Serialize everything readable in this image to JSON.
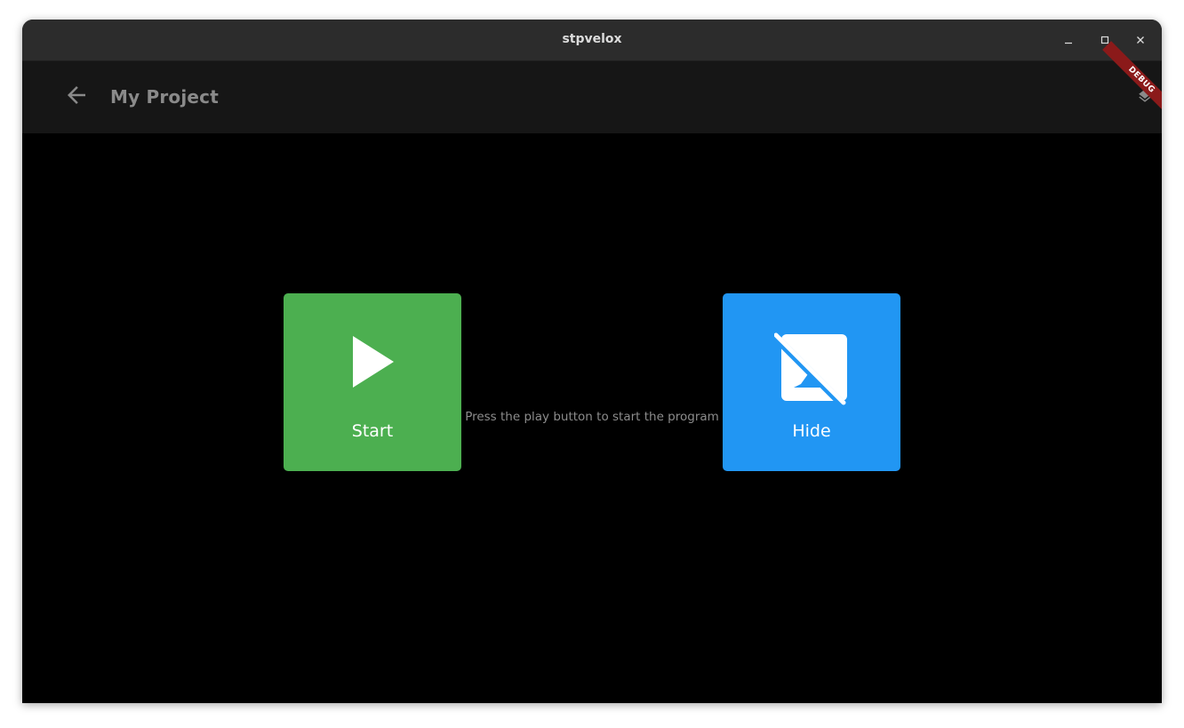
{
  "window": {
    "title": "stpvelox",
    "controls": [
      "minimize-icon",
      "maximize-icon",
      "close-icon"
    ]
  },
  "appbar": {
    "title": "My Project",
    "back_icon": "arrow-back-icon",
    "layers_icon": "layers-icon",
    "debug_banner": "DEBUG"
  },
  "main": {
    "start_tile": {
      "label": "Start",
      "icon": "play-icon",
      "color": "#4caf50"
    },
    "hint": "Press the play button to start the program",
    "hide_tile": {
      "label": "Hide",
      "icon": "hide-image-icon",
      "color": "#2196f3"
    }
  },
  "colors": {
    "titlebar": "#2c2c2c",
    "appbar": "#161616",
    "background": "#000000",
    "debug_banner": "#8b1a1a"
  }
}
